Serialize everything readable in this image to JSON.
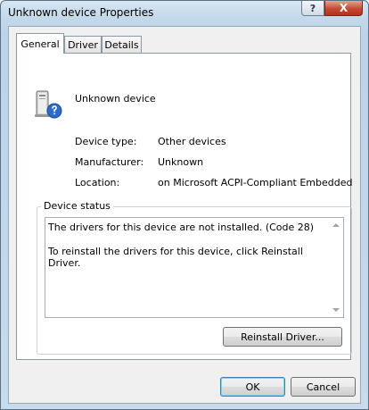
{
  "window": {
    "title": "Unknown device Properties"
  },
  "titlebar": {
    "help_glyph": "?",
    "close_glyph": "X"
  },
  "tabs": [
    {
      "label": "General",
      "active": true
    },
    {
      "label": "Driver",
      "active": false
    },
    {
      "label": "Details",
      "active": false
    }
  ],
  "device": {
    "icon": "unknown-device-icon",
    "name": "Unknown device",
    "properties": [
      {
        "label": "Device type:",
        "value": "Other devices"
      },
      {
        "label": "Manufacturer:",
        "value": "Unknown"
      },
      {
        "label": "Location:",
        "value": "on Microsoft ACPI-Compliant Embedded Contro"
      }
    ]
  },
  "status": {
    "legend": "Device status",
    "lines": [
      "The drivers for this device are not installed. (Code 28)",
      "To reinstall the drivers for this device, click Reinstall Driver."
    ],
    "reinstall_label": "Reinstall Driver..."
  },
  "dialog_buttons": {
    "ok_label": "OK",
    "cancel_label": "Cancel"
  },
  "colors": {
    "close_button": "#c54a32",
    "ok_focus": "#3c7fb1"
  }
}
